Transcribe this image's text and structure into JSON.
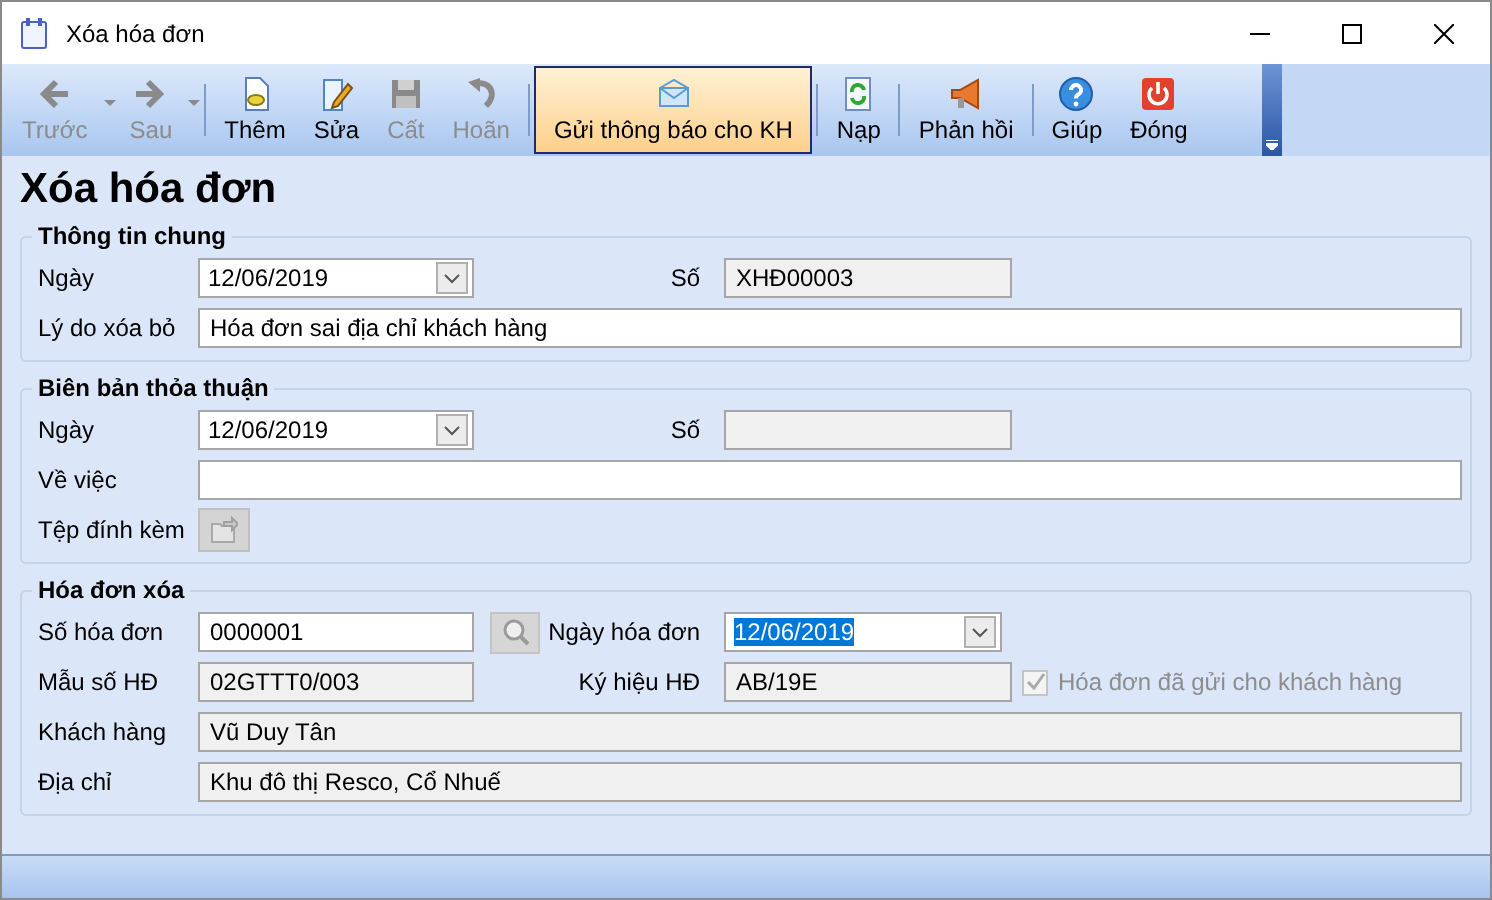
{
  "window": {
    "title": "Xóa hóa đơn"
  },
  "toolbar": [
    {
      "label": "Trước",
      "disabled": true,
      "dropdown": true,
      "selected": false
    },
    {
      "label": "Sau",
      "disabled": true,
      "dropdown": true,
      "selected": false
    },
    {
      "label": "Thêm",
      "disabled": false,
      "dropdown": false,
      "selected": false
    },
    {
      "label": "Sửa",
      "disabled": false,
      "dropdown": false,
      "selected": false
    },
    {
      "label": "Cất",
      "disabled": true,
      "dropdown": false,
      "selected": false
    },
    {
      "label": "Hoãn",
      "disabled": true,
      "dropdown": false,
      "selected": false
    },
    {
      "label": "Gửi thông báo cho KH",
      "disabled": false,
      "dropdown": false,
      "selected": true
    },
    {
      "label": "Nạp",
      "disabled": false,
      "dropdown": false,
      "selected": false
    },
    {
      "label": "Phản hồi",
      "disabled": false,
      "dropdown": false,
      "selected": false
    },
    {
      "label": "Giúp",
      "disabled": false,
      "dropdown": false,
      "selected": false
    },
    {
      "label": "Đóng",
      "disabled": false,
      "dropdown": false,
      "selected": false
    }
  ],
  "heading": "Xóa hóa đơn",
  "sections": [
    {
      "title": "Thông tin chung",
      "rows": [
        [
          {
            "kind": "date",
            "label": "Ngày",
            "value": "12/06/2019",
            "selected": false
          },
          {
            "kind": "text",
            "label": "Số",
            "value": "XHĐ00003",
            "disabled": true
          }
        ],
        [
          {
            "kind": "text",
            "label": "Lý do xóa bỏ",
            "value": "Hóa đơn sai địa chỉ khách hàng",
            "disabled": false
          }
        ]
      ]
    },
    {
      "title": "Biên bản thỏa thuận",
      "rows": [
        [
          {
            "kind": "date",
            "label": "Ngày",
            "value": "12/06/2019",
            "selected": false
          },
          {
            "kind": "text",
            "label": "Số",
            "disabled": true
          }
        ],
        [
          {
            "kind": "text",
            "label": "Về việc",
            "disabled": false
          }
        ],
        [
          {
            "kind": "attach",
            "label": "Tệp đính kèm"
          }
        ]
      ]
    },
    {
      "title": "Hóa đơn xóa",
      "rows": [
        [
          {
            "kind": "lookup",
            "label": "Số hóa đơn",
            "value": "0000001",
            "disabled": false
          },
          {
            "kind": "date",
            "label": "Ngày hóa đơn",
            "value": "12/06/2019",
            "selected": true
          }
        ],
        [
          {
            "kind": "text",
            "label": "Mẫu số HĐ",
            "value": "02GTTT0/003",
            "disabled": true
          },
          {
            "kind": "text",
            "label": "Ký hiệu HĐ",
            "value": "AB/19E",
            "disabled": true
          },
          {
            "kind": "checkbox",
            "label": "Hóa đơn đã gửi cho khách hàng",
            "checked": true,
            "disabled": true
          }
        ],
        [
          {
            "kind": "text",
            "label": "Khách hàng",
            "value": "Vũ Duy Tân",
            "disabled": true
          }
        ],
        [
          {
            "kind": "text",
            "label": "Địa chỉ",
            "value": "Khu đô thị Resco, Cổ Nhuế",
            "disabled": true
          }
        ]
      ]
    }
  ]
}
